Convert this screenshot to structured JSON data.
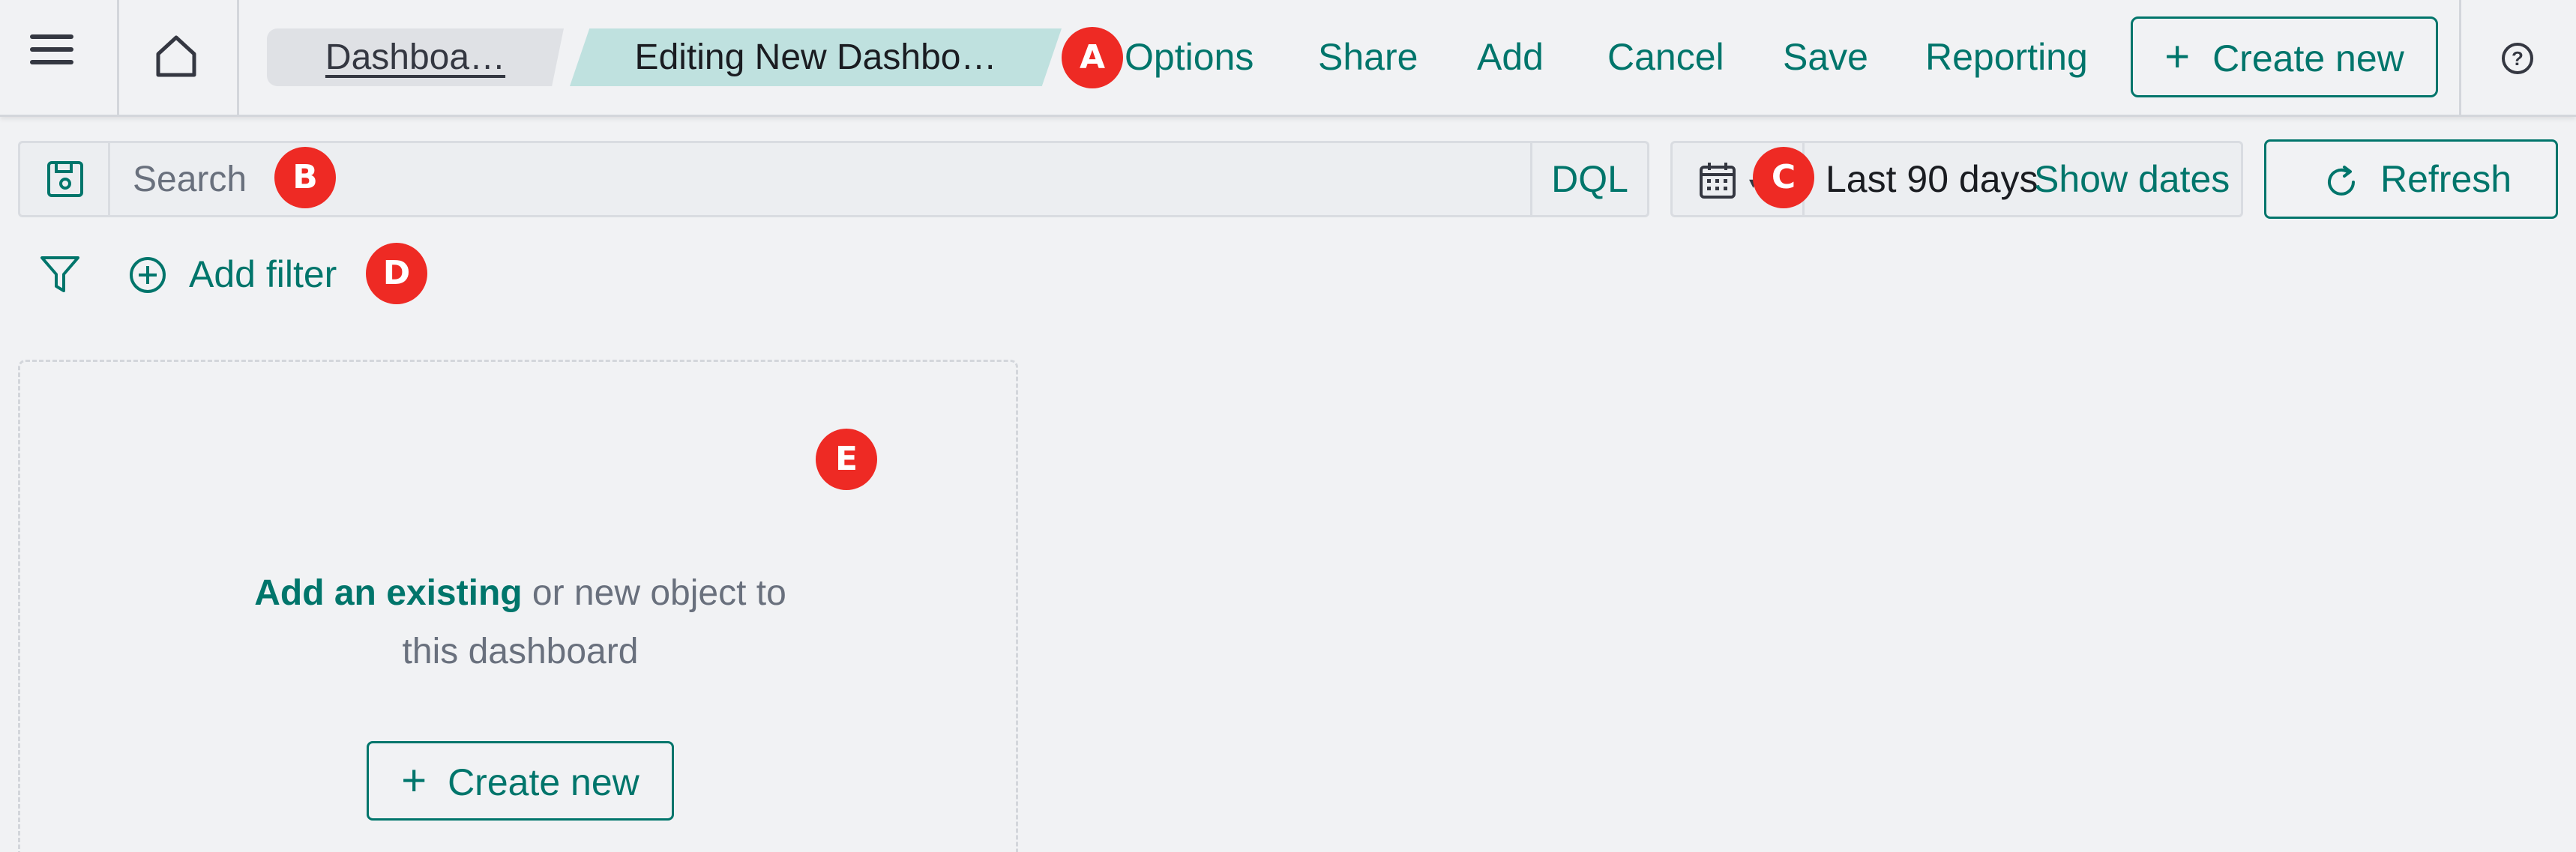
{
  "header": {
    "breadcrumbs": [
      "Dashboa…",
      "Editing New Dashbo…"
    ],
    "nav": {
      "options": "Options",
      "share": "Share",
      "add": "Add",
      "cancel": "Cancel",
      "save": "Save",
      "reporting": "Reporting"
    },
    "create_new": "Create new",
    "icons": [
      "hamburger-menu-icon",
      "home-icon",
      "help-icon"
    ]
  },
  "query_bar": {
    "placeholder": "Search",
    "language": "DQL",
    "date_range": "Last 90 days",
    "show_dates": "Show dates",
    "refresh": "Refresh"
  },
  "filter_bar": {
    "add_filter": "Add filter"
  },
  "panel": {
    "link_text": "Add an existing",
    "text_rest": " or new object to",
    "text_line2": "this dashboard",
    "create_new": "Create new"
  },
  "markers": {
    "a": "A",
    "b": "B",
    "c": "C",
    "d": "D",
    "e": "E"
  },
  "colors": {
    "accent": "#00756b",
    "marker": "#ee2a24",
    "breadcrumb_active": "#bfe1df",
    "background": "#f1f2f4"
  }
}
